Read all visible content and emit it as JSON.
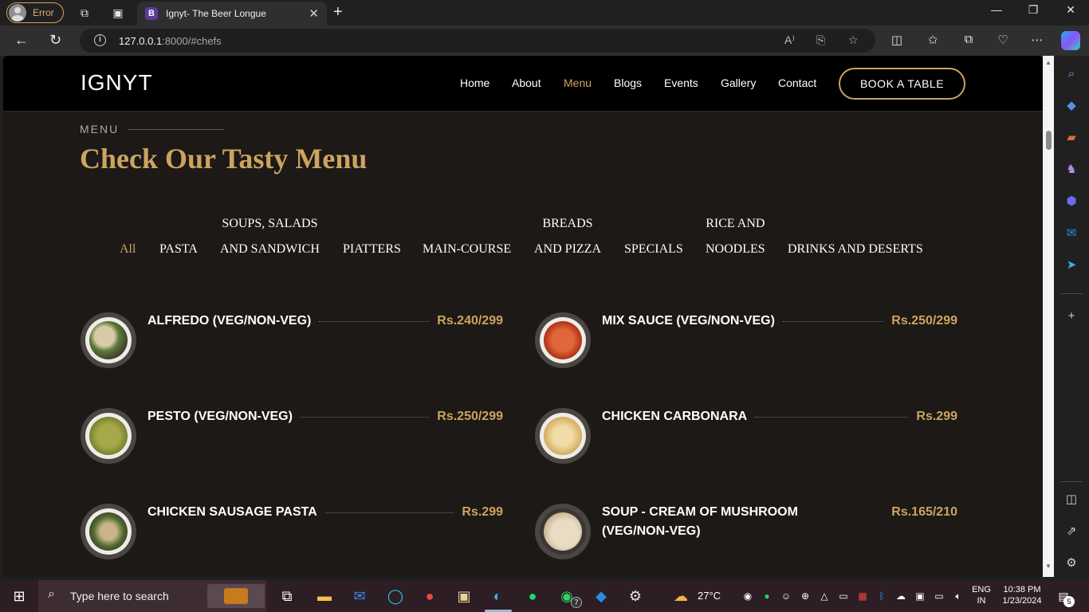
{
  "browser": {
    "profile_label": "Error",
    "tab_title": "Ignyt- The Beer Longue",
    "tab_favicon": "B",
    "url_host": "127.0.0.1",
    "url_rest": ":8000/#chefs"
  },
  "site": {
    "logo": "IGNYT",
    "nav": [
      "Home",
      "About",
      "Menu",
      "Blogs",
      "Events",
      "Gallery",
      "Contact"
    ],
    "active_nav": "Menu",
    "book_button": "BOOK A TABLE",
    "section_label": "MENU",
    "section_title": "Check Our Tasty Menu",
    "filters": [
      {
        "line1": "",
        "line2": "All"
      },
      {
        "line1": "",
        "line2": "PASTA"
      },
      {
        "line1": "SOUPS, SALADS",
        "line2": "AND SANDWICH"
      },
      {
        "line1": "",
        "line2": "PIATTERS"
      },
      {
        "line1": "",
        "line2": "MAIN-COURSE"
      },
      {
        "line1": "BREADS",
        "line2": "AND PIZZA"
      },
      {
        "line1": "",
        "line2": "SPECIALS"
      },
      {
        "line1": "RICE AND",
        "line2": "NOODLES"
      },
      {
        "line1": "",
        "line2": "DRINKS AND DESERTS"
      }
    ],
    "menu_items": [
      {
        "name": "ALFREDO (VEG/NON-VEG)",
        "price": "Rs.240/299"
      },
      {
        "name": "MIX SAUCE (VEG/NON-VEG)",
        "price": "Rs.250/299"
      },
      {
        "name": "PESTO (VEG/NON-VEG)",
        "price": "Rs.250/299"
      },
      {
        "name": "CHICKEN CARBONARA",
        "price": "Rs.299"
      },
      {
        "name": "CHICKEN SAUSAGE PASTA",
        "price": "Rs.299"
      },
      {
        "name": "SOUP - CREAM OF MUSHROOM (VEG/NON-VEG)",
        "price": "Rs.165/210"
      }
    ]
  },
  "taskbar": {
    "search_placeholder": "Type here to search",
    "weather": "27°C",
    "lang_line1": "ENG",
    "lang_line2": "IN",
    "time": "10:38 PM",
    "date": "1/23/2024",
    "whatsapp_badge": "7",
    "notification_badge": "5"
  },
  "colors": {
    "accent": "#cda45e",
    "page_bg": "#1c1917",
    "header_bg": "#000000"
  }
}
